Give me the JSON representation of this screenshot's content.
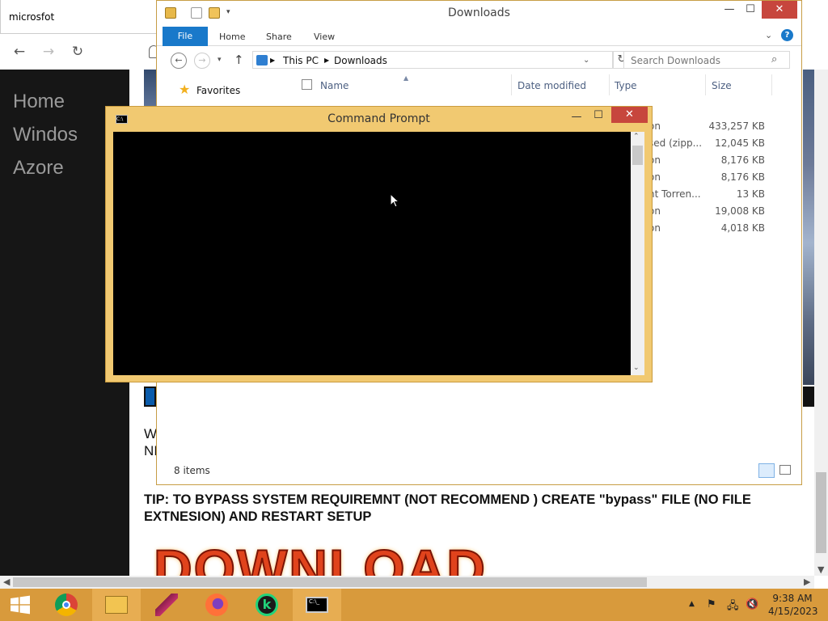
{
  "browser": {
    "tab_title": "microsfot",
    "nav": {
      "back": "←",
      "forward": "→",
      "refresh": "↻"
    },
    "sidebar_links": [
      "Home",
      "Windos",
      "Azore"
    ],
    "page_fragment_1": "W",
    "page_fragment_2": "NI",
    "tip": "TIP: TO BYPASS SYSTEM REQUIREMNT (NOT RECOMMEND ) CREATE \"bypass\" FILE (NO FILE EXTNESION) AND RESTART SETUP",
    "download_banner": "DOWNLOAD"
  },
  "explorer": {
    "title": "Downloads",
    "controls": {
      "minimize": "—",
      "maximize": "☐",
      "close": "✕"
    },
    "ribbon_tabs": [
      "File",
      "Home",
      "Share",
      "View"
    ],
    "address": {
      "root": "This PC",
      "folder": "Downloads"
    },
    "search_placeholder": "Search Downloads",
    "nav_favorites": "Favorites",
    "columns": {
      "name": "Name",
      "date_modified": "Date modified",
      "type": "Type",
      "size": "Size"
    },
    "rows": [
      {
        "type": "r",
        "size": ""
      },
      {
        "type": "on",
        "size": "433,257 KB"
      },
      {
        "type": "sed (zipp...",
        "size": "12,045 KB"
      },
      {
        "type": "on",
        "size": "8,176 KB"
      },
      {
        "type": "on",
        "size": "8,176 KB"
      },
      {
        "type": "nt Torren...",
        "size": "13 KB"
      },
      {
        "type": "on",
        "size": "19,008 KB"
      },
      {
        "type": "on",
        "size": "4,018 KB"
      }
    ],
    "status": "8 items"
  },
  "cmd": {
    "title": "Command Prompt",
    "icon_text": "C:\\",
    "controls": {
      "minimize": "—",
      "maximize": "☐",
      "close": "✕"
    }
  },
  "taskbar": {
    "pinned": [
      "start",
      "chrome",
      "file-explorer",
      "feather-app",
      "firefox",
      "kaspersky",
      "command-prompt"
    ],
    "time": "9:38 AM",
    "date": "4/15/2023"
  },
  "colors": {
    "window_frame": "#f1c971",
    "taskbar": "#d89a3c",
    "explorer_file_tab": "#1979ca",
    "close_red": "#c7463d",
    "dark_sidebar": "#161616"
  }
}
